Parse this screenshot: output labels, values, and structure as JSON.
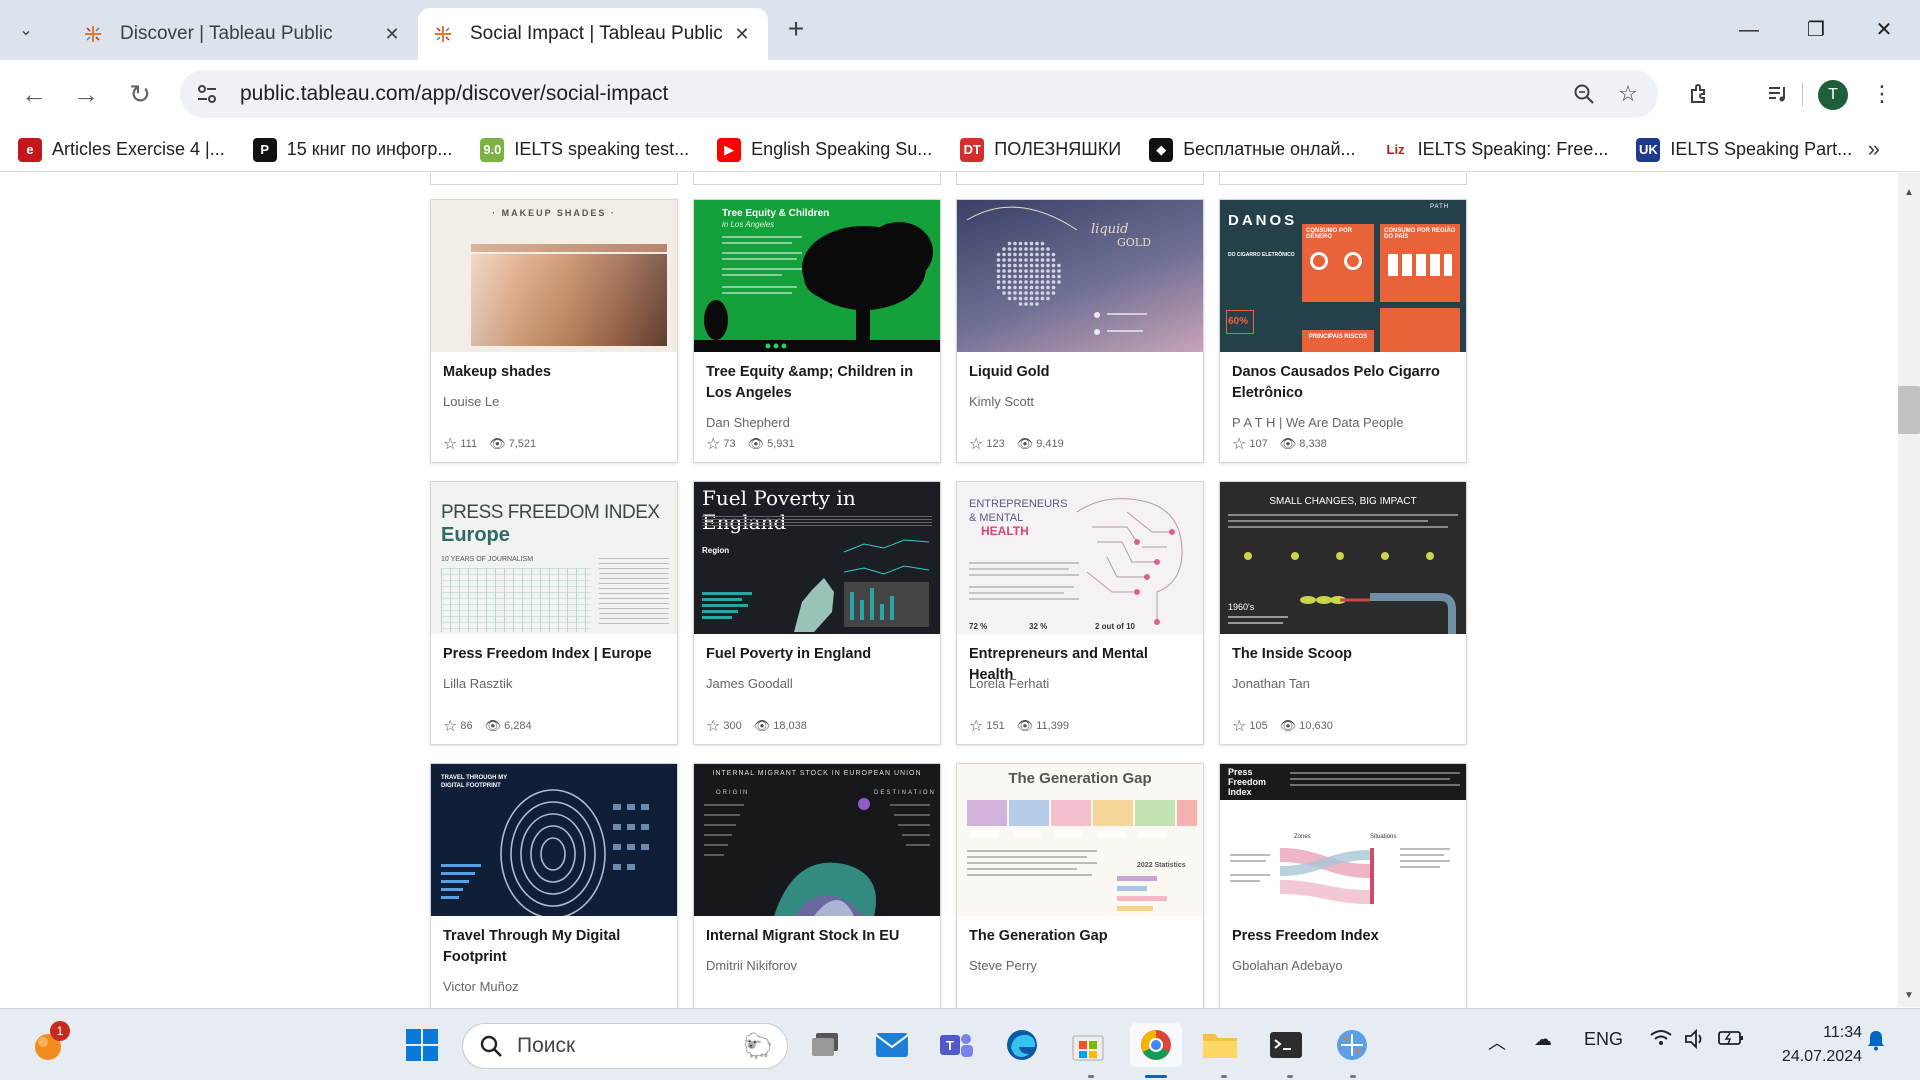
{
  "browser": {
    "tabs": [
      {
        "title": "Discover | Tableau Public",
        "active": false
      },
      {
        "title": "Social Impact | Tableau Public",
        "active": true
      }
    ],
    "url": "public.tableau.com/app/discover/social-impact",
    "profile_initial": "T",
    "bookmarks": [
      {
        "label": "Articles Exercise 4 |...",
        "icon_text": "e",
        "color": "#c4161c"
      },
      {
        "label": "15 книг по инфогр...",
        "icon_text": "P",
        "color": "#111111"
      },
      {
        "label": "IELTS speaking test...",
        "icon_text": "9.0",
        "color": "#7cb342"
      },
      {
        "label": "English Speaking Su...",
        "icon_text": "▶",
        "color": "#ff0000"
      },
      {
        "label": "ПОЛЕЗНЯШКИ",
        "icon_text": "DT",
        "color": "#d32f2f"
      },
      {
        "label": "Бесплатные онлай...",
        "icon_text": "◆",
        "color": "#111111"
      },
      {
        "label": "IELTS Speaking: Free...",
        "icon_text": "Liz",
        "color": "#ffffff"
      },
      {
        "label": "IELTS Speaking Part...",
        "icon_text": "UK",
        "color": "#1e3a8a"
      }
    ]
  },
  "gallery": {
    "cards": [
      {
        "title": "Makeup shades",
        "author": "Louise Le",
        "favorites": "111",
        "views": "7,521"
      },
      {
        "title": "Tree Equity &amp; Children in Los Angeles",
        "author": "Dan Shepherd",
        "favorites": "73",
        "views": "5,931"
      },
      {
        "title": "Liquid Gold",
        "author": "Kimly Scott",
        "favorites": "123",
        "views": "9,419"
      },
      {
        "title": "Danos Causados Pelo Cigarro Eletrônico",
        "author": "P A T H | We Are Data People",
        "favorites": "107",
        "views": "8,338"
      },
      {
        "title": "Press Freedom Index | Europe",
        "author": "Lilla Rasztik",
        "favorites": "86",
        "views": "6,284"
      },
      {
        "title": "Fuel Poverty in England",
        "author": "James Goodall",
        "favorites": "300",
        "views": "18,038"
      },
      {
        "title": "Entrepreneurs and Mental Health",
        "author": "Lorela Ferhati",
        "favorites": "151",
        "views": "11,399"
      },
      {
        "title": "The Inside Scoop",
        "author": "Jonathan Tan",
        "favorites": "105",
        "views": "10,630"
      },
      {
        "title": "Travel Through My Digital Footprint",
        "author": "Victor Muñoz",
        "favorites": "",
        "views": ""
      },
      {
        "title": "Internal Migrant Stock In EU",
        "author": "Dmitrii Nikiforov",
        "favorites": "",
        "views": ""
      },
      {
        "title": "The Generation Gap",
        "author": "Steve Perry",
        "favorites": "",
        "views": ""
      },
      {
        "title": "Press Freedom Index",
        "author": "Gbolahan Adebayo",
        "favorites": "",
        "views": ""
      }
    ],
    "thumbnails": {
      "makeup": {
        "title": "· MAKEUP SHADES ·"
      },
      "tree": {
        "title": "Tree Equity & Children",
        "subtitle": "in Los Angeles"
      },
      "liquid": {
        "title": "liquid",
        "title2": "GOLD"
      },
      "danos": {
        "title": "DANOS",
        "subtitle": "DO CIGARRO ELETRÔNICO",
        "stat": "60%",
        "box1": "CONSUMO POR GÊNERO",
        "box2": "CONSUMO POR REGIÃO DO PAÍS",
        "box3": "PRINCIPAIS RISCOS",
        "path": "PATH"
      },
      "pfi_europe": {
        "title": "PRESS FREEDOM INDEX",
        "title2": "Europe",
        "subtitle": "10 YEARS OF JOURNALISM"
      },
      "fuel": {
        "title": "Fuel Poverty in England",
        "region": "Region"
      },
      "entre": {
        "l1": "ENTREPRENEURS",
        "l2": "& MENTAL",
        "l3": "HEALTH",
        "s1": "72 %",
        "s2": "32 %",
        "s3": "2 out of 10"
      },
      "scoop": {
        "title": "SMALL CHANGES, BIG IMPACT",
        "year": "1960's"
      },
      "travel": {
        "title": "TRAVEL THROUGH MY DIGITAL FOOTPRINT"
      },
      "migrant": {
        "title": "INTERNAL MIGRANT STOCK IN EUROPEAN UNION",
        "origin": "ORIGIN",
        "destination": "DESTINATION"
      },
      "gengap": {
        "title": "The Generation Gap",
        "stats": "2022 Statistics"
      },
      "pfi": {
        "title": "Press Freedom Index",
        "zones": "Zones",
        "situations": "Situations"
      }
    }
  },
  "taskbar": {
    "search_placeholder": "Поиск",
    "notification_count": "1",
    "language": "ENG",
    "time": "11:34",
    "date": "24.07.2024"
  },
  "colors": {
    "tabstrip": "#dde3ea",
    "omnibox": "#eef1f6",
    "taskbar": "#e7ecf3",
    "accent": "#0067c0"
  }
}
